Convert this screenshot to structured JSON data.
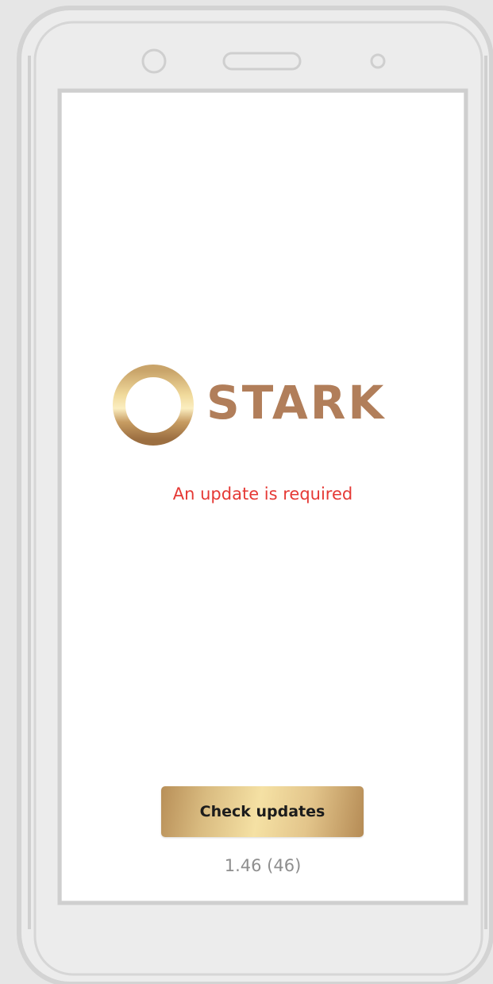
{
  "colors": {
    "brand": "#b17e5a",
    "alert": "#e53935",
    "device_frame": "#d3d3d3",
    "background": "#e6e6e6"
  },
  "logo": {
    "text": "STARK",
    "icon": "gold-ring-icon"
  },
  "status": {
    "message": "An update is required"
  },
  "actions": {
    "check_updates_label": "Check updates"
  },
  "app": {
    "version": "1.46 (46)"
  }
}
